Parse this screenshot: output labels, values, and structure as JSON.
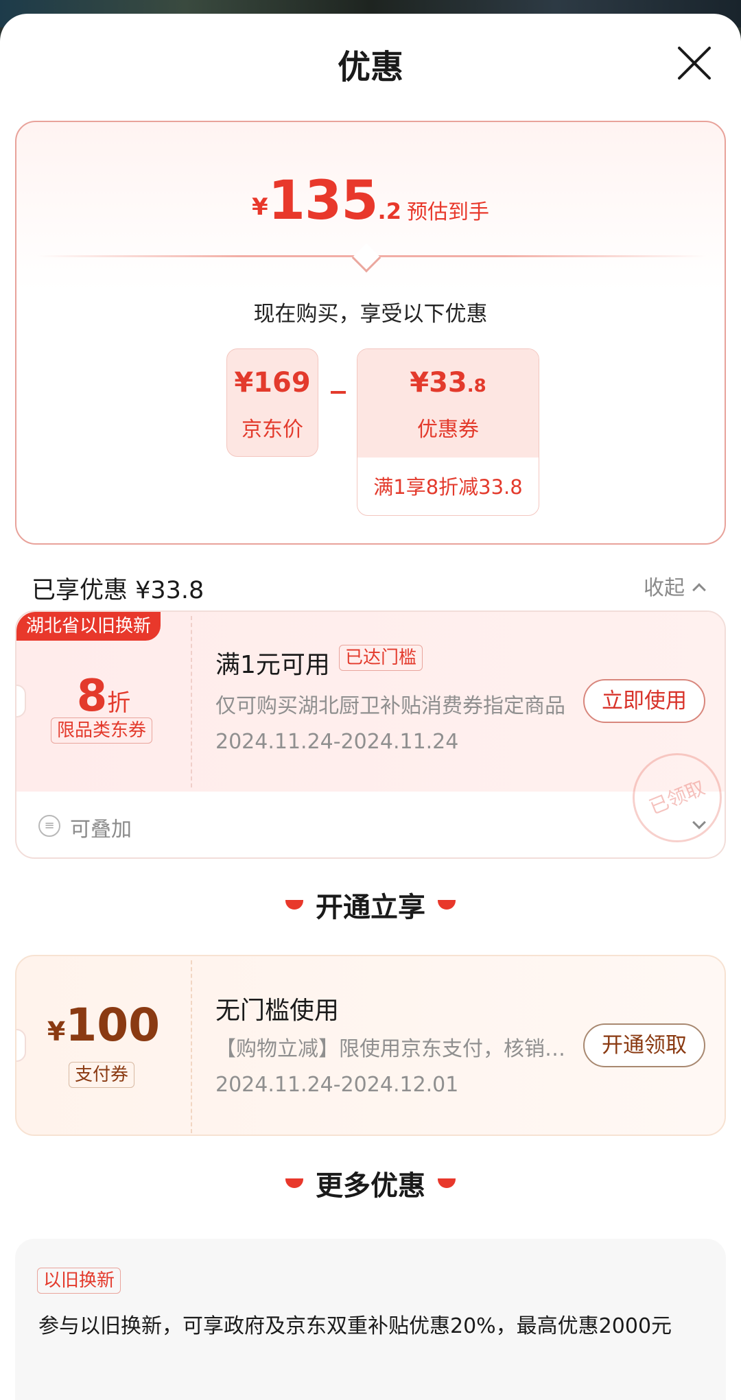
{
  "sheet": {
    "title": "优惠"
  },
  "summary": {
    "currency": "¥",
    "estimate_int": "135",
    "estimate_dec": ".2",
    "estimate_label": "预估到手",
    "enjoy_text": "现在购买，享受以下优惠",
    "price_box": {
      "amount": "¥169",
      "label": "京东价"
    },
    "minus_sign": "−",
    "coupon_box": {
      "amount_main": "¥33",
      "amount_dec": ".8",
      "label": "优惠券",
      "rule": "满1享8折减33.8"
    }
  },
  "enjoyed": {
    "title": "已享优惠 ¥33.8",
    "collapse_label": "收起"
  },
  "coupon1": {
    "region_tag": "湖北省以旧换新",
    "discount_value": "8",
    "discount_unit": "折",
    "category_tag": "限品类东券",
    "title": "满1元可用",
    "status_tag": "已达门槛",
    "desc": "仅可购买湖北厨卫补贴消费券指定商品",
    "date": "2024.11.24-2024.11.24",
    "button": "立即使用",
    "stamp": "已领取",
    "stack_label": "可叠加"
  },
  "section_open": {
    "title": "开通立享"
  },
  "coupon2": {
    "currency": "¥",
    "amount": "100",
    "type_tag": "支付券",
    "title": "无门槛使用",
    "desc": "【购物立减】限使用京东支付，核销后立减",
    "date": "2024.11.24-2024.12.01",
    "button": "开通领取"
  },
  "section_more": {
    "title": "更多优惠"
  },
  "more": {
    "tag": "以旧换新",
    "text": "参与以旧换新，可享政府及京东双重补贴优惠20%，最高优惠2000元"
  },
  "colors": {
    "accent": "#e8382b",
    "gold_dark": "#8a3a12"
  }
}
